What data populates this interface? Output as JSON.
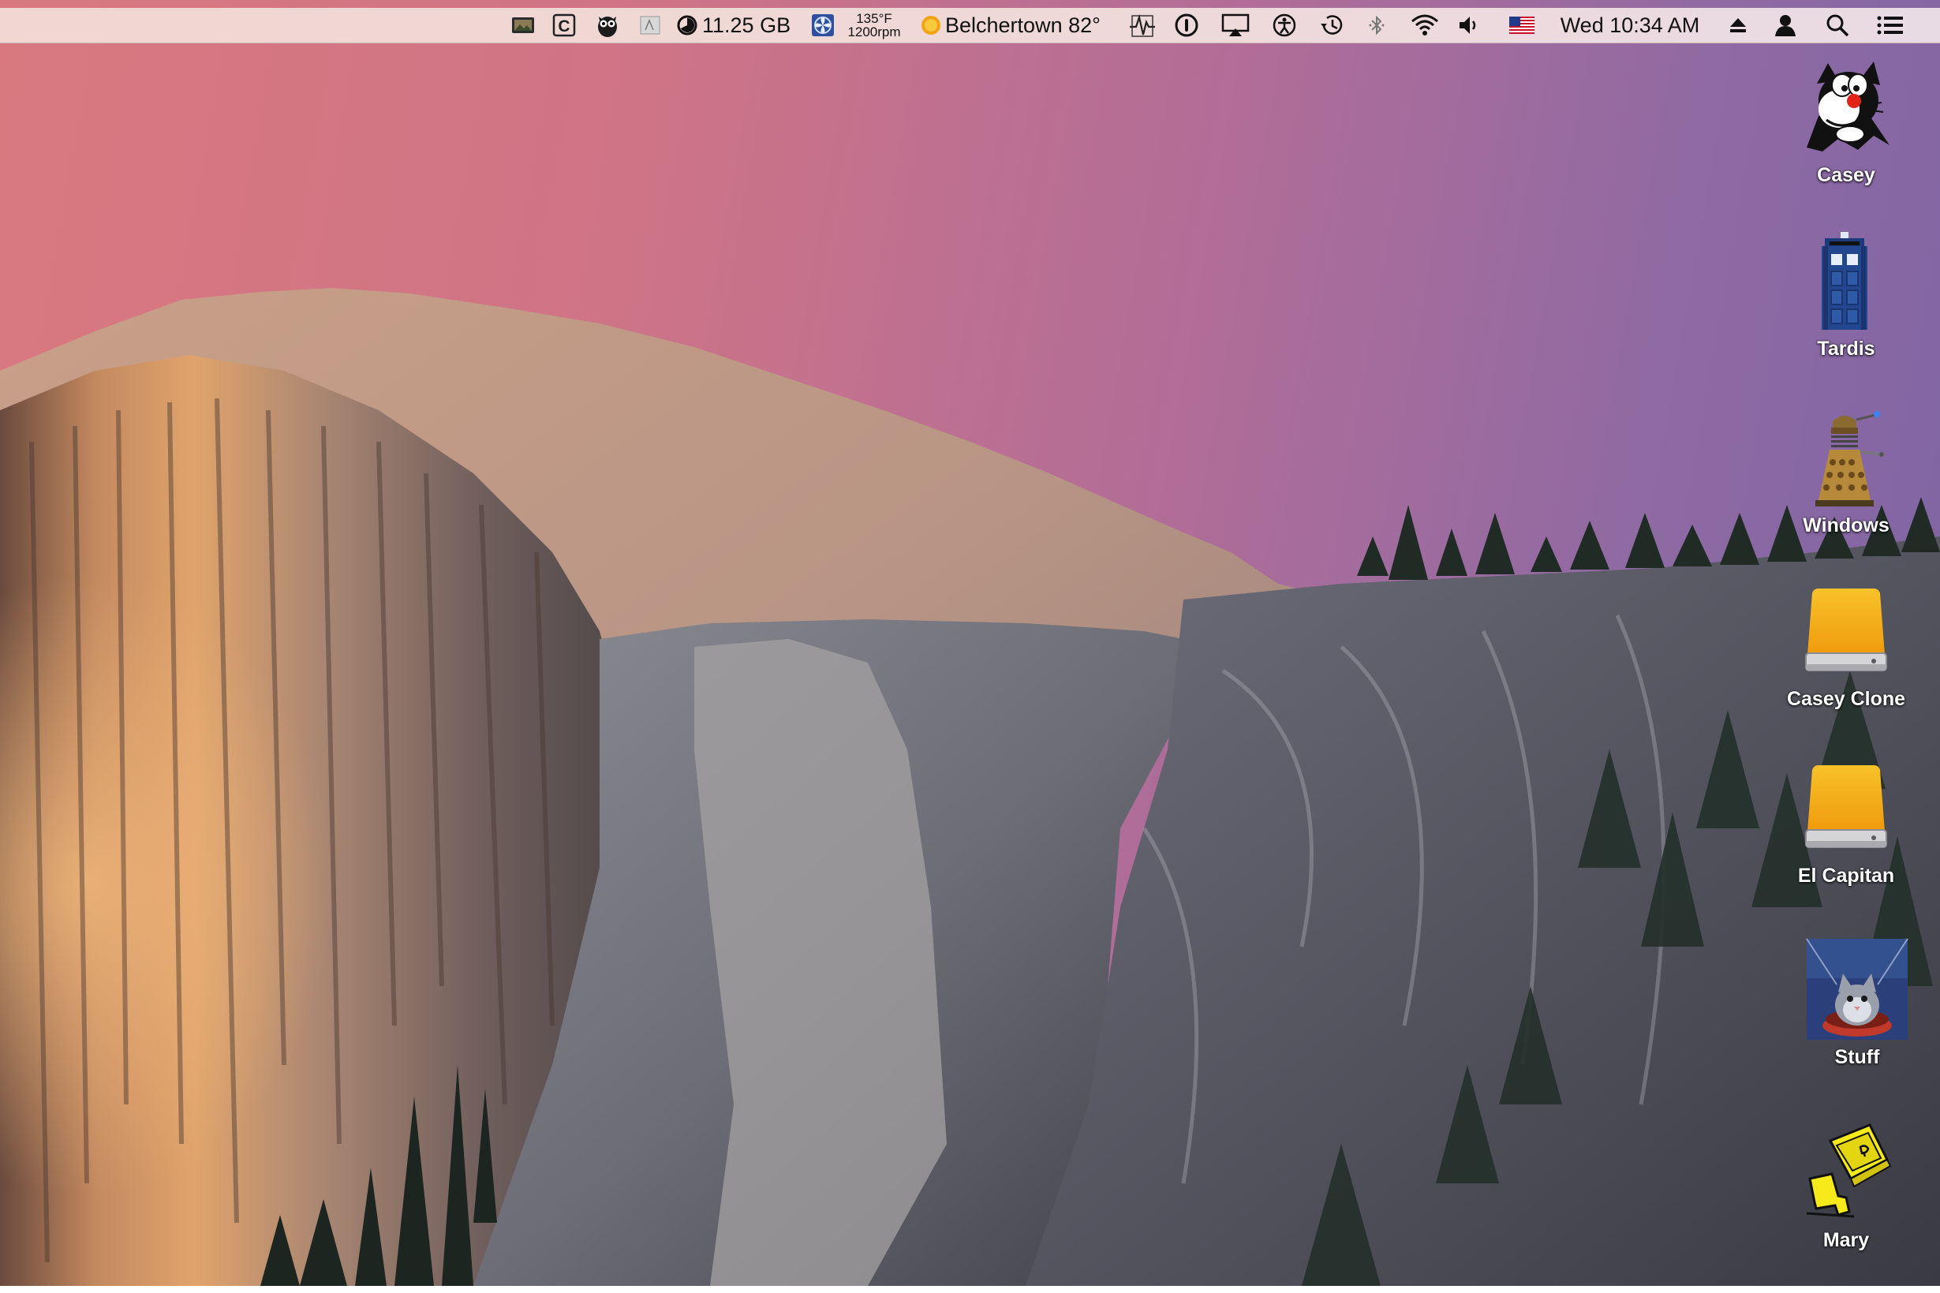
{
  "menubar": {
    "storage": "11.25 GB",
    "temp": "135°F",
    "fan": "1200rpm",
    "weather": "Belchertown 82°",
    "clock": "Wed 10:34 AM",
    "icons": [
      "photo-icon",
      "c-app-icon",
      "owl-icon",
      "tray-icon",
      "disk-gauge-icon",
      "fan-icon",
      "weather-sun-icon",
      "activity-monitor-icon",
      "password-icon",
      "airplay-icon",
      "accessibility-icon",
      "time-machine-icon",
      "bluetooth-icon",
      "wifi-icon",
      "volume-icon",
      "us-flag-icon",
      "eject-icon",
      "user-icon",
      "spotlight-icon",
      "notification-center-icon"
    ]
  },
  "desktop": {
    "icons": [
      {
        "label": "Casey",
        "kind": "sylvester-icon"
      },
      {
        "label": "Tardis",
        "kind": "tardis-icon"
      },
      {
        "label": "Windows",
        "kind": "dalek-icon"
      },
      {
        "label": "Casey Clone",
        "kind": "external-drive-icon"
      },
      {
        "label": "El Capitan",
        "kind": "external-drive-icon"
      },
      {
        "label": "Stuff",
        "kind": "cat-folder-icon"
      },
      {
        "label": "Mary",
        "kind": "yellow-mac-icon"
      }
    ]
  },
  "colors": {
    "sky_left": "#d9787f",
    "sky_right": "#7c64a4",
    "drive_orange": "#f6a512",
    "label_text": "#ffffff"
  }
}
